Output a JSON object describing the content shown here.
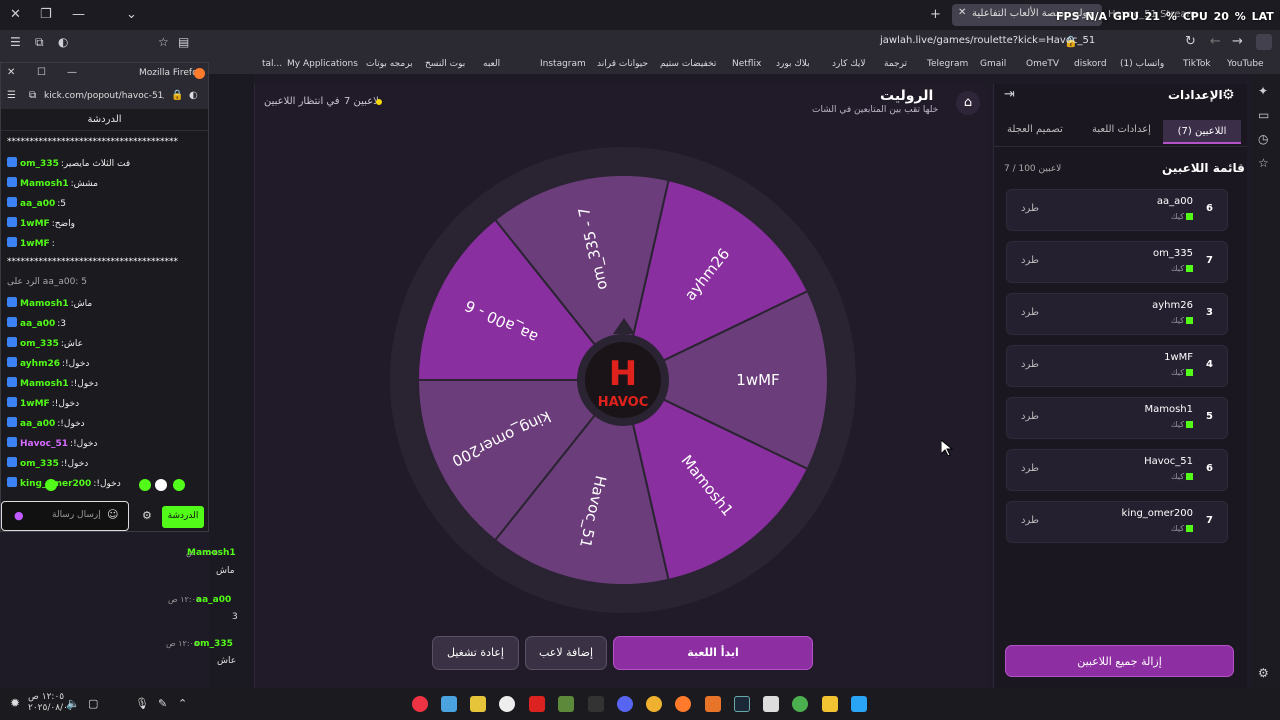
{
  "browser": {
    "active_tab_label": "جوله - منصة الألعاب التفاعلية",
    "other_tab_label": "Havoc_51 Stream",
    "overlay_stats": "FPS N/A   GPU 21 %   CPU 20 %   LAT N/A",
    "url": "jawlah.live/games/roulette?kick=Havoc_51",
    "bookmarks": [
      "YouTube",
      "TikTok",
      "(1) واتساب",
      "diskord",
      "OmeTV",
      "Gmail",
      "Telegram",
      "ترجمة",
      "لايك كارد",
      "بلاك بورد",
      "Netflix",
      "تخفيضات ستيم",
      "حيوانات قراند",
      "Instagram",
      "العبه",
      "بوت النسخ",
      "برمجه بوتات",
      "My Applications",
      "tal..."
    ]
  },
  "popup": {
    "window_title": "Mozilla Firefox",
    "url": "kick.com/popout/havoc-51/chat",
    "chat_label": "الدردشة",
    "messages": [
      {
        "user": "",
        "text": "**************************************",
        "color": "#ffffff"
      },
      {
        "user": "om_335",
        "text": "فت الثلاث مايصير",
        "color": "#53fc18"
      },
      {
        "user": "Mamosh1",
        "text": "مشش",
        "color": "#53fc18"
      },
      {
        "user": "aa_a00",
        "text": "5",
        "color": "#53fc18"
      },
      {
        "user": "1wMF",
        "text": "واضح",
        "color": "#53fc18"
      },
      {
        "user": "1wMF",
        "text": "",
        "color": "#53fc18"
      },
      {
        "user": "",
        "text": "**************************************",
        "color": "#ffffff"
      },
      {
        "user": "",
        "text": "الرد على aa_a00: 5",
        "color": "#aaaaaa"
      },
      {
        "user": "Mamosh1",
        "text": "ماش",
        "color": "#53fc18"
      },
      {
        "user": "aa_a00",
        "text": "3",
        "color": "#53fc18"
      },
      {
        "user": "om_335",
        "text": "عاش",
        "color": "#53fc18"
      },
      {
        "user": "ayhm26",
        "text": "!دخول",
        "color": "#53fc18"
      },
      {
        "user": "Mamosh1",
        "text": "!دخول",
        "color": "#53fc18"
      },
      {
        "user": "1wMF",
        "text": "!دخول",
        "color": "#53fc18"
      },
      {
        "user": "aa_a00",
        "text": "!دخول",
        "color": "#53fc18"
      },
      {
        "user": "Havoc_51",
        "text": "!دخول",
        "color": "#d66bff"
      },
      {
        "user": "om_335",
        "text": "!دخول",
        "color": "#53fc18"
      },
      {
        "user": "king_omer200",
        "text": "!دخول",
        "color": "#53fc18"
      }
    ],
    "input_placeholder": "إرسال رسالة",
    "chat_button": "الدردشة"
  },
  "app": {
    "title": "الروليت",
    "subtitle": "خلها تقب بين المتابعين في الشات",
    "status_waiting": "في انتظار اللاعبين",
    "status_count": "7 لاعبين",
    "wheel_center_logo": "HAVOC",
    "wheel_segments": [
      "1wMF",
      "ayhm26",
      "om_335 - 7",
      "aa_a00 - 6",
      "king_omer200",
      "Havoc_51",
      "Mamosh1"
    ],
    "wheel_colors": [
      "#8a2fa0",
      "#6b3d7a",
      "#8a2fa0",
      "#6b3d7a",
      "#6b3d7a",
      "#8a2fa0",
      "#6b3d7a"
    ],
    "buttons": {
      "start": "ابدأ اللعبة",
      "add": "إضافة لاعب",
      "reset": "إعادة تشغيل"
    }
  },
  "settings": {
    "title": "الإعدادات",
    "tabs": {
      "players": "اللاعبين (7)",
      "game": "إعدادات اللعبة",
      "design": "تصميم العجلة"
    },
    "list_title": "قائمة اللاعبين",
    "list_count": "7 / 100 لاعبين",
    "kick_label": "طرد",
    "platform_label": "كيك",
    "players": [
      {
        "name": "aa_a00",
        "num": "6"
      },
      {
        "name": "om_335",
        "num": "7"
      },
      {
        "name": "ayhm26",
        "num": "3"
      },
      {
        "name": "1wMF",
        "num": "4"
      },
      {
        "name": "Mamosh1",
        "num": "5"
      },
      {
        "name": "Havoc_51",
        "num": "6"
      },
      {
        "name": "king_omer200",
        "num": "7"
      }
    ],
    "remove_all": "إزالة جميع اللاعبين"
  },
  "stream_chat": [
    {
      "user": "Mamosh1",
      "time": "١٢:٠٥ ص",
      "text": "ماش"
    },
    {
      "user": "aa_a00",
      "time": "١٢:٠٥ ص",
      "text": "3"
    },
    {
      "user": "om_335",
      "time": "١٢:٠٥ ص",
      "text": "عاش"
    }
  ],
  "taskbar": {
    "time": "١٢:٠٥ ص",
    "date": "٢٠٢٥/٠٨/٠٧"
  }
}
